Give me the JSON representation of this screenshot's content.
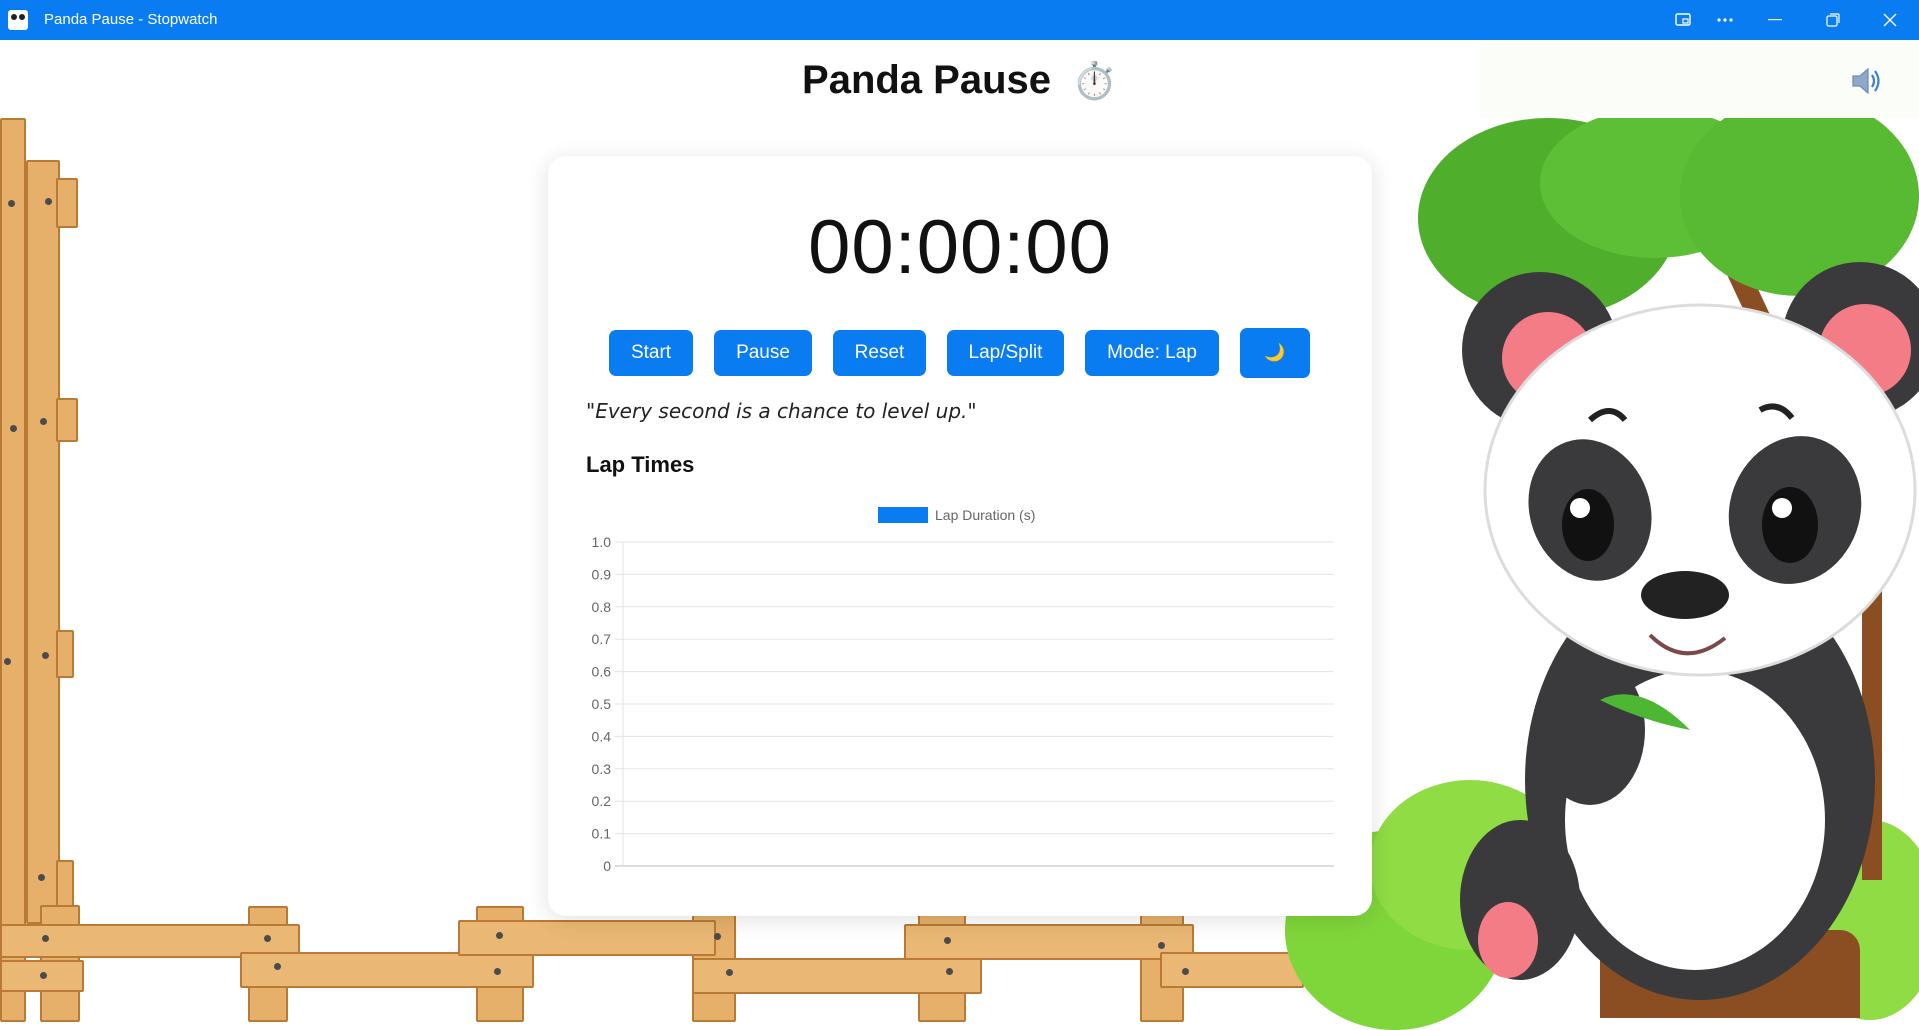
{
  "window": {
    "title": "Panda Pause - Stopwatch",
    "controls": [
      "cast-icon",
      "more-icon",
      "minimize-icon",
      "restore-icon",
      "close-icon"
    ]
  },
  "header": {
    "title": "Panda Pause",
    "title_emoji": "⏱️",
    "sound_icon": "speaker-icon"
  },
  "stopwatch": {
    "time": "00:00:00",
    "buttons": {
      "start": "Start",
      "pause": "Pause",
      "reset": "Reset",
      "lap": "Lap/Split",
      "mode": "Mode: Lap",
      "theme": "🌙"
    },
    "quote": "\"Every second is a chance to level up.\""
  },
  "laps": {
    "heading": "Lap Times"
  },
  "colors": {
    "accent": "#0a7cf2",
    "titlebar": "#0a7cf2"
  },
  "chart_data": {
    "type": "bar",
    "title": "",
    "categories": [],
    "series": [
      {
        "name": "Lap Duration (s)",
        "values": [],
        "color": "#0a7cf2"
      }
    ],
    "xlabel": "",
    "ylabel": "",
    "ylim": [
      0,
      1
    ],
    "yticks": [
      "0",
      "0.1",
      "0.2",
      "0.3",
      "0.4",
      "0.5",
      "0.6",
      "0.7",
      "0.8",
      "0.9",
      "1.0"
    ],
    "grid": true,
    "legend": "top-center"
  }
}
